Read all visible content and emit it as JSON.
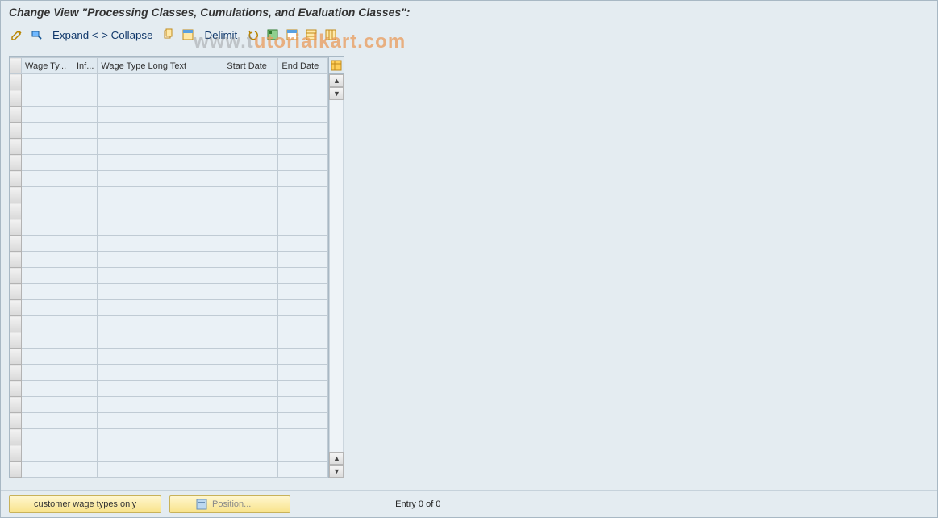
{
  "header": {
    "title": "Change View \"Processing Classes, Cumulations, and Evaluation Classes\":"
  },
  "toolbar": {
    "expand_collapse_label": "Expand <-> Collapse",
    "delimit_label": "Delimit"
  },
  "watermark": {
    "gray_prefix": "www.t",
    "orange_suffix": "utorialkart.com"
  },
  "table": {
    "columns": [
      {
        "label": "Wage Ty...",
        "width": 64
      },
      {
        "label": "Inf...",
        "width": 30
      },
      {
        "label": "Wage Type Long Text",
        "width": 156
      },
      {
        "label": "Start Date",
        "width": 68
      },
      {
        "label": "End Date",
        "width": 62
      }
    ],
    "row_count": 25
  },
  "footer": {
    "customer_btn": "customer wage types only",
    "position_btn": "Position...",
    "entry_text": "Entry 0 of 0"
  }
}
